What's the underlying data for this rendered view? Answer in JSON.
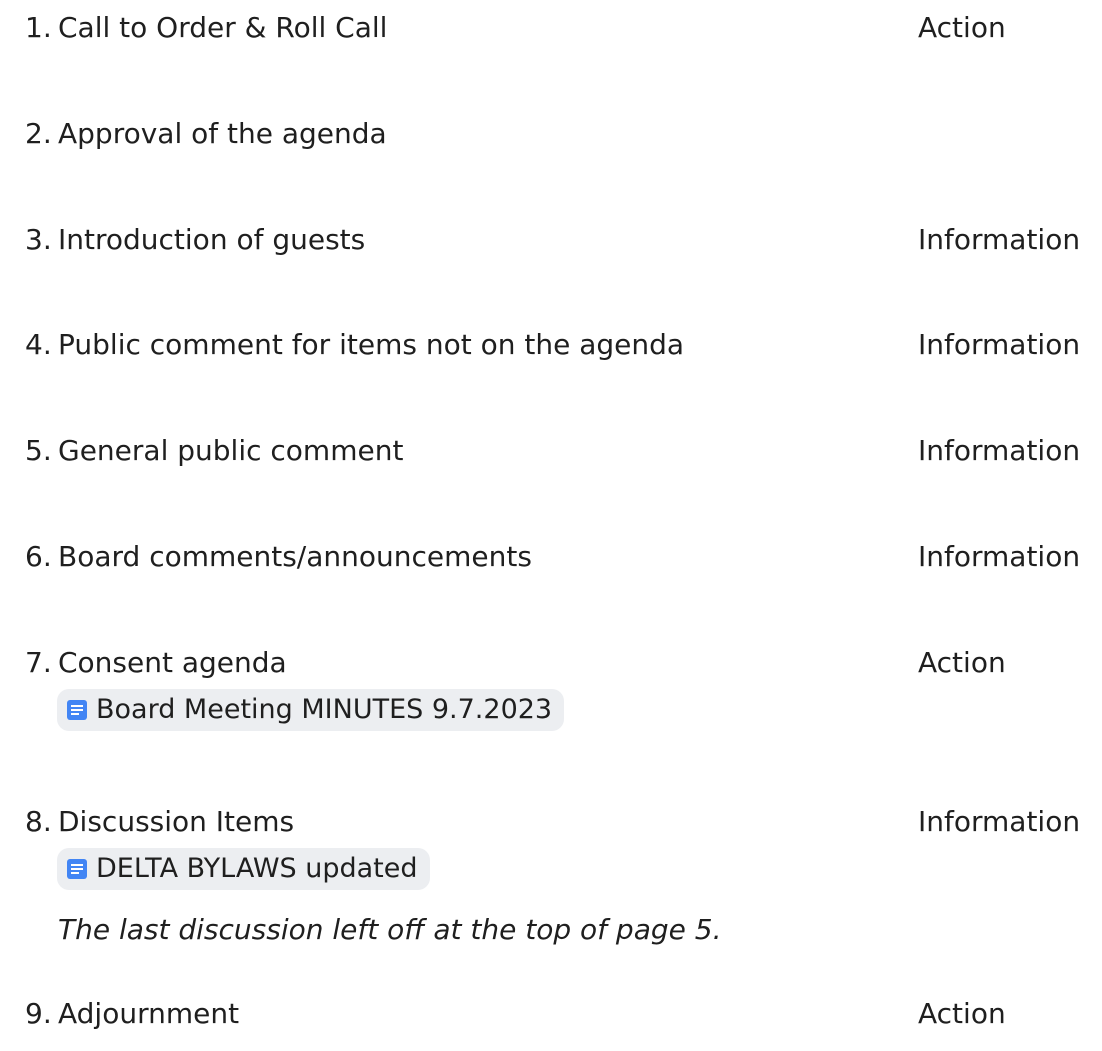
{
  "agenda": {
    "items": [
      {
        "number": "1.",
        "title": "Call to Order & Roll Call",
        "type": "Action"
      },
      {
        "number": "2.",
        "title": "Approval of the agenda",
        "type": ""
      },
      {
        "number": "3.",
        "title": "Introduction of guests",
        "type": "Information"
      },
      {
        "number": "4.",
        "title": "Public comment for items not on the agenda",
        "type": "Information"
      },
      {
        "number": "5.",
        "title": "General public comment",
        "type": "Information"
      },
      {
        "number": "6.",
        "title": "Board comments/announcements",
        "type": "Information"
      },
      {
        "number": "7.",
        "title": "Consent agenda",
        "type": "Action",
        "attachment": {
          "label": "Board Meeting MINUTES 9.7.2023",
          "icon": "doc-icon"
        }
      },
      {
        "number": "8.",
        "title": "Discussion Items",
        "type": "Information",
        "attachment": {
          "label": "DELTA BYLAWS updated",
          "icon": "doc-icon"
        },
        "note": "The last discussion left off at the top of page 5."
      },
      {
        "number": "9.",
        "title": "Adjournment",
        "type": "Action"
      }
    ],
    "colors": {
      "text": "#1f1f1f",
      "chip_background": "#eceef1",
      "doc_icon": "#4285f4"
    }
  }
}
